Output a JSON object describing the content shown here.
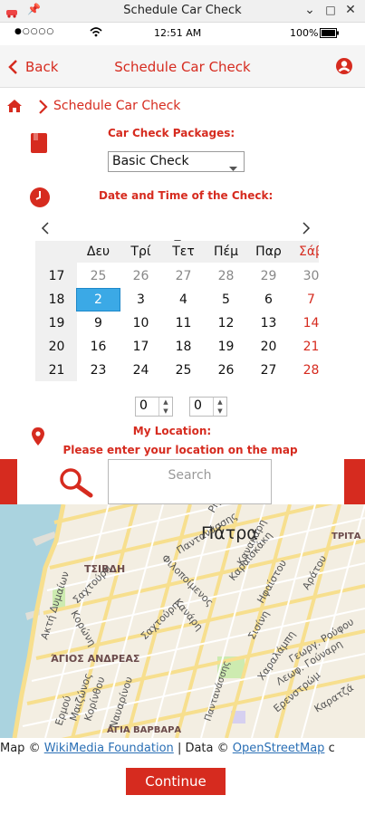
{
  "window": {
    "title": "Schedule Car Check"
  },
  "status": {
    "dots": "●○○○○",
    "time": "12:51 AM",
    "battery": "100%"
  },
  "appbar": {
    "back_label": "Back",
    "title": "Schedule Car Check"
  },
  "breadcrumb": {
    "current": "Schedule Car Check"
  },
  "packages": {
    "label": "Car Check Packages:",
    "selected": "Basic Check"
  },
  "datetime": {
    "label": "Date and Time of the Check:"
  },
  "calendar": {
    "weekdays": [
      "Δευ",
      "Τρί",
      "Τετ",
      "Πέμ",
      "Παρ",
      "Σάβ"
    ],
    "rows": [
      {
        "week": "17",
        "days": [
          "25",
          "26",
          "27",
          "28",
          "29",
          "30"
        ]
      },
      {
        "week": "18",
        "days": [
          "2",
          "3",
          "4",
          "5",
          "6",
          "7"
        ]
      },
      {
        "week": "19",
        "days": [
          "9",
          "10",
          "11",
          "12",
          "13",
          "14"
        ]
      },
      {
        "week": "20",
        "days": [
          "16",
          "17",
          "18",
          "19",
          "20",
          "21"
        ]
      },
      {
        "week": "21",
        "days": [
          "23",
          "24",
          "25",
          "26",
          "27",
          "28"
        ]
      }
    ],
    "selected_day": "2"
  },
  "time": {
    "hours": "0",
    "minutes": "0"
  },
  "location": {
    "label": "My Location:",
    "hint": "Please enter your location on the map",
    "search_placeholder": "Search"
  },
  "map": {
    "labels": {
      "city": "Πάτρα",
      "tsivdi": "ΤΣΙΒΔΗ",
      "agios_andreas": "ΆΓΙΟΣ ΑΝΔΡΕΑΣ",
      "agia_varvara": "ΑΓΙΑ ΒΑΡΒΑΡΑ",
      "tripia": "ΤΡΙΤΑ",
      "st1": "Παντανάσσης",
      "st2": "Καραϊσκάκη",
      "st3": "Φιλοποίμενος",
      "st4": "Σαχτούρη",
      "st5": "Κανάρη",
      "st6": "Ηφαίστου",
      "st7": "Αράτου",
      "st8": "Ακτή Δυμαίων",
      "st9": "Κορώνη",
      "st10": "Ερμού",
      "st11": "Μαιζώνος",
      "st12": "Κορίνθου",
      "st13": "Ναυαρίνου",
      "st14": "Σισίνη",
      "st15": "Χαραλάμπη",
      "st16": "Γεωργ. Ρούφου",
      "st17": "Λεωφ. Γούναρη",
      "st18": "Ερενστρώμ",
      "st19": "Καρατζά",
      "st20": "Κανακάρη",
      "st21": "Ρήγα"
    },
    "attribution": {
      "prefix": "Map ©",
      "link1": "WikiMedia Foundation",
      "sep": "| Data ©",
      "link2": "OpenStreetMap",
      "suffix": "c"
    }
  },
  "continue_label": "Continue"
}
